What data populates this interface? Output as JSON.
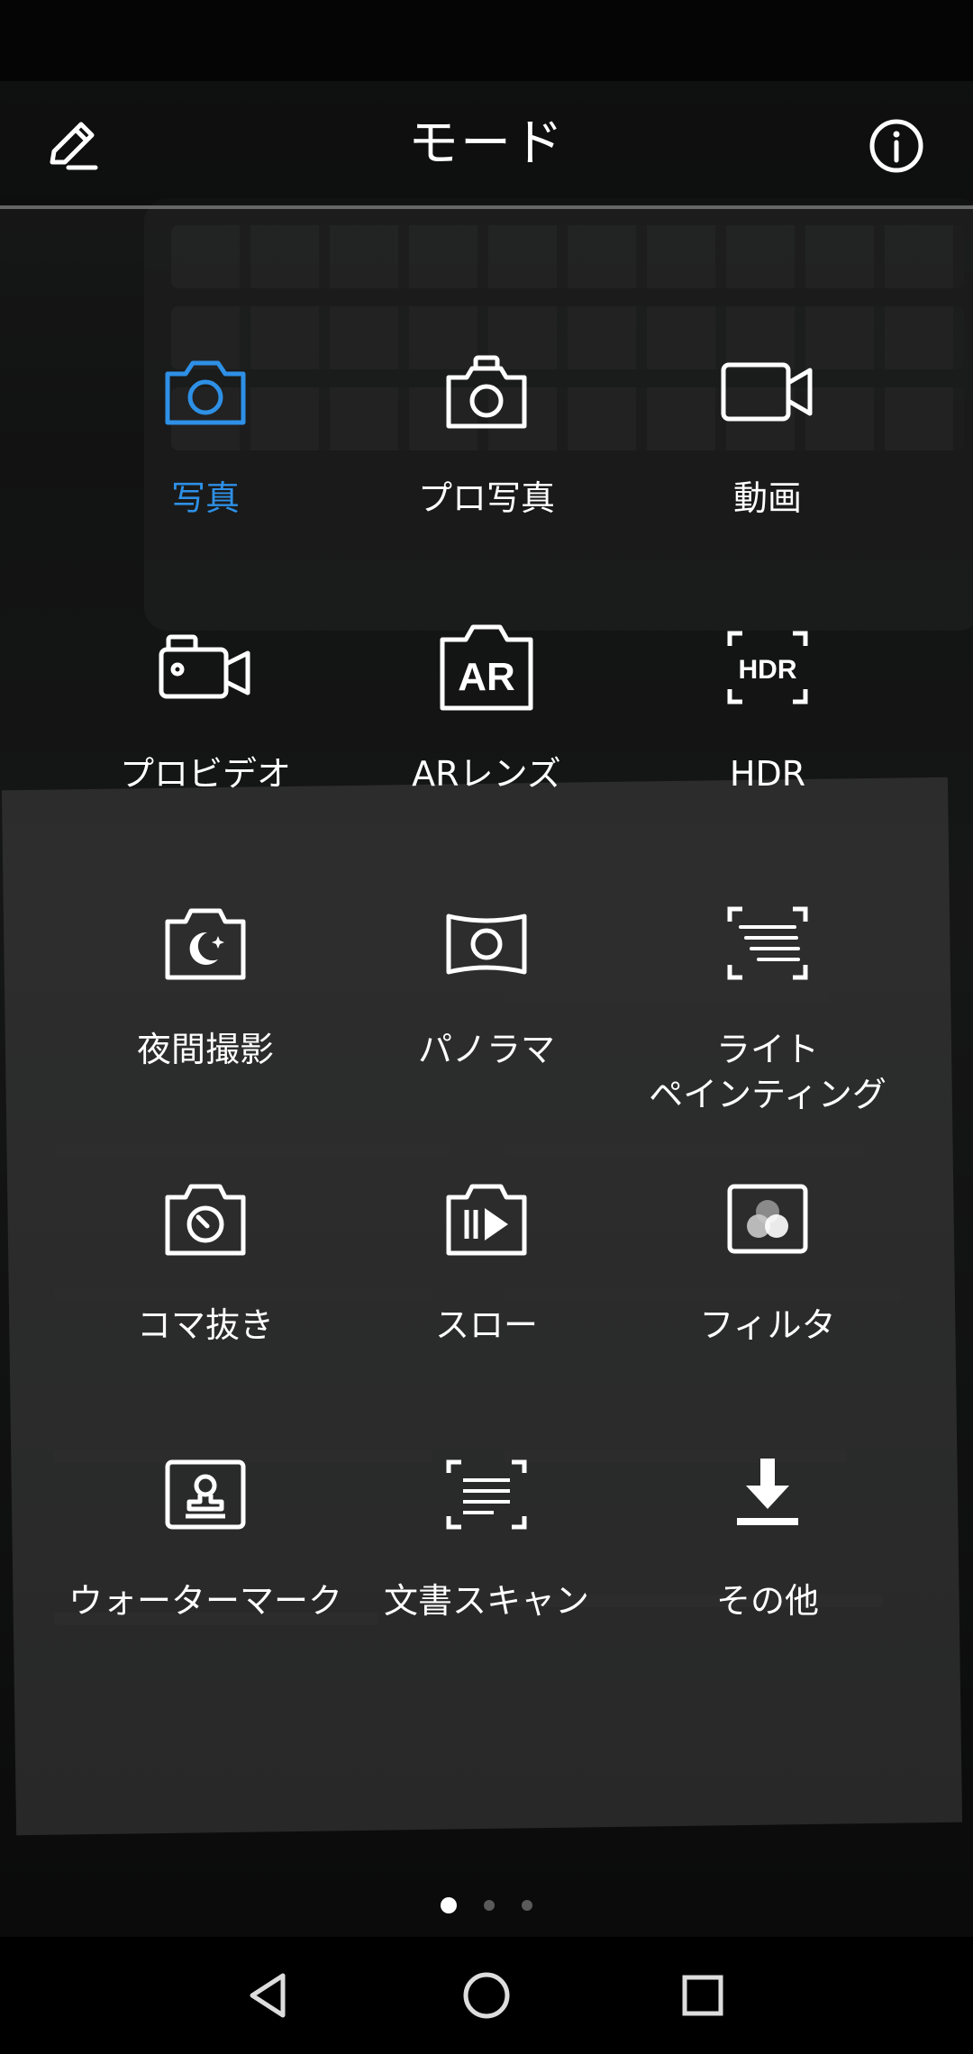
{
  "header": {
    "title": "モード",
    "edit_icon": "pencil-icon",
    "info_icon": "info-icon"
  },
  "modes": [
    {
      "label": "写真",
      "icon": "camera-icon",
      "active": true
    },
    {
      "label": "プロ写真",
      "icon": "pro-camera-icon",
      "active": false
    },
    {
      "label": "動画",
      "icon": "video-camera-icon",
      "active": false
    },
    {
      "label": "プロビデオ",
      "icon": "pro-video-icon",
      "active": false
    },
    {
      "label": "ARレンズ",
      "icon": "ar-lens-icon",
      "active": false
    },
    {
      "label": "HDR",
      "icon": "hdr-icon",
      "active": false
    },
    {
      "label": "夜間撮影",
      "icon": "night-mode-icon",
      "active": false
    },
    {
      "label": "パノラマ",
      "icon": "panorama-icon",
      "active": false
    },
    {
      "label": "ライト\nペインティング",
      "icon": "light-painting-icon",
      "active": false
    },
    {
      "label": "コマ抜き",
      "icon": "time-lapse-icon",
      "active": false
    },
    {
      "label": "スロー",
      "icon": "slow-motion-icon",
      "active": false
    },
    {
      "label": "フィルタ",
      "icon": "filter-icon",
      "active": false
    },
    {
      "label": "ウォーターマーク",
      "icon": "watermark-icon",
      "active": false
    },
    {
      "label": "文書スキャン",
      "icon": "document-scan-icon",
      "active": false
    },
    {
      "label": "その他",
      "icon": "download-icon",
      "active": false
    }
  ],
  "pager": {
    "pages": 3,
    "current": 1
  },
  "navigation": {
    "back_icon": "back-triangle-icon",
    "home_icon": "home-circle-icon",
    "recents_icon": "recents-square-icon"
  },
  "colors": {
    "accent": "#2e90e6",
    "text": "#ffffff"
  }
}
